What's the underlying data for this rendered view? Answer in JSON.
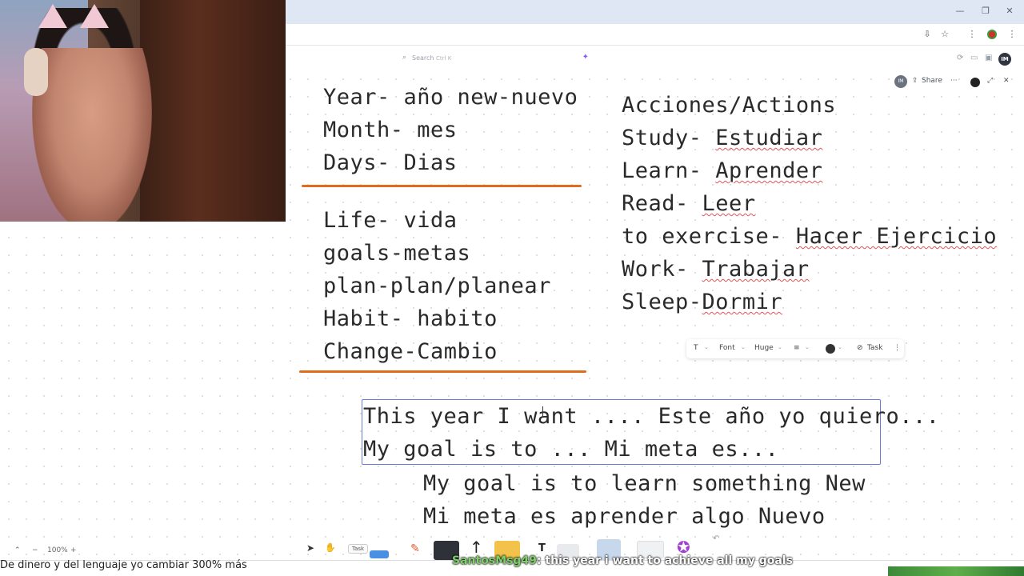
{
  "browser": {
    "window_controls": {
      "minimize": "—",
      "restore": "❐",
      "close": "✕"
    }
  },
  "app_toolbar": {
    "search_placeholder": "Search",
    "search_shortcut": "Ctrl K",
    "avatar_initials": "IM"
  },
  "share_bar": {
    "avatar_initials": "IM",
    "share_label": "Share",
    "more": "···"
  },
  "board": {
    "group_time": [
      "Year- año  new-nuevo",
      "Month- mes",
      "Days- Dias"
    ],
    "group_life": [
      "Life- vida",
      "goals-metas",
      "plan-plan/planear",
      "Habit- habito",
      "Change-Cambio"
    ],
    "group_actions": {
      "heading": "Acciones/Actions",
      "items": [
        [
          "Study- ",
          "Estudiar"
        ],
        [
          "Learn- ",
          "Aprender"
        ],
        [
          "Read- ",
          "Leer"
        ],
        [
          "to exercise- ",
          "Hacer Ejercicio"
        ],
        [
          "Work- ",
          "Trabajar"
        ],
        [
          "Sleep-",
          "Dormir"
        ]
      ]
    },
    "selected_text": [
      "This year I want .... Este año yo quiero...",
      "My goal is to ... Mi meta es..."
    ],
    "example_text": [
      "My goal is to learn something New",
      "Mi meta es aprender algo Nuevo"
    ]
  },
  "format_toolbar": {
    "text_type": "T",
    "font_label": "Font",
    "size_label": "Huge",
    "align": "≡",
    "task_label": "Task",
    "more": "⋮"
  },
  "zoom": {
    "value": "100%",
    "minus": "−",
    "plus": "+"
  },
  "dock": {
    "task_chip": "Task",
    "text_tool": "T"
  },
  "stream_overlay": {
    "ticker": "De dinero y del lenguaje yo cambiar 300% más",
    "chat_user": "SantosMsg49",
    "chat_separator": ": ",
    "chat_message": "this year i want to achieve all my goals"
  }
}
